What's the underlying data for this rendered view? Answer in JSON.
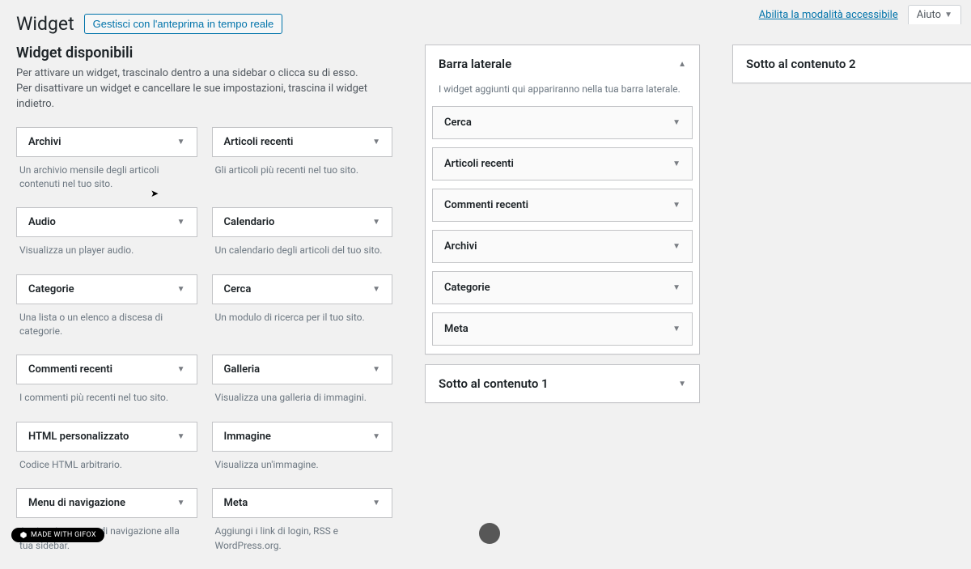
{
  "topbar": {
    "accessible_mode": "Abilita la modalità accessibile",
    "help": "Aiuto"
  },
  "heading": {
    "title": "Widget",
    "action": "Gestisci con l'anteprima in tempo reale"
  },
  "available": {
    "heading": "Widget disponibili",
    "description": "Per attivare un widget, trascinalo dentro a una sidebar o clicca su di esso. Per disattivare un widget e cancellare le sue impostazioni, trascina il widget indietro.",
    "items": [
      {
        "title": "Archivi",
        "desc": "Un archivio mensile degli articoli contenuti nel tuo sito."
      },
      {
        "title": "Articoli recenti",
        "desc": "Gli articoli più recenti nel tuo sito."
      },
      {
        "title": "Audio",
        "desc": "Visualizza un player audio."
      },
      {
        "title": "Calendario",
        "desc": "Un calendario degli articoli del tuo sito."
      },
      {
        "title": "Categorie",
        "desc": "Una lista o un elenco a discesa di categorie."
      },
      {
        "title": "Cerca",
        "desc": "Un modulo di ricerca per il tuo sito."
      },
      {
        "title": "Commenti recenti",
        "desc": "I commenti più recenti nel tuo sito."
      },
      {
        "title": "Galleria",
        "desc": "Visualizza una galleria di immagini."
      },
      {
        "title": "HTML personalizzato",
        "desc": "Codice HTML arbitrario."
      },
      {
        "title": "Immagine",
        "desc": "Visualizza un'immagine."
      },
      {
        "title": "Menu di navigazione",
        "desc": "Aggiungi un menu di navigazione alla tua sidebar."
      },
      {
        "title": "Meta",
        "desc": "Aggiungi i link di login, RSS e WordPress.org."
      }
    ]
  },
  "areas": {
    "sidebar": {
      "title": "Barra laterale",
      "desc": "I widget aggiunti qui appariranno nella tua barra laterale.",
      "expanded": true,
      "widgets": [
        {
          "title": "Cerca"
        },
        {
          "title": "Articoli recenti"
        },
        {
          "title": "Commenti recenti"
        },
        {
          "title": "Archivi"
        },
        {
          "title": "Categorie"
        },
        {
          "title": "Meta"
        }
      ]
    },
    "below1": {
      "title": "Sotto al contenuto 1",
      "expanded": false
    },
    "below2": {
      "title": "Sotto al contenuto 2",
      "expanded": false
    }
  },
  "badge": {
    "label": "MADE WITH GIFOX"
  }
}
